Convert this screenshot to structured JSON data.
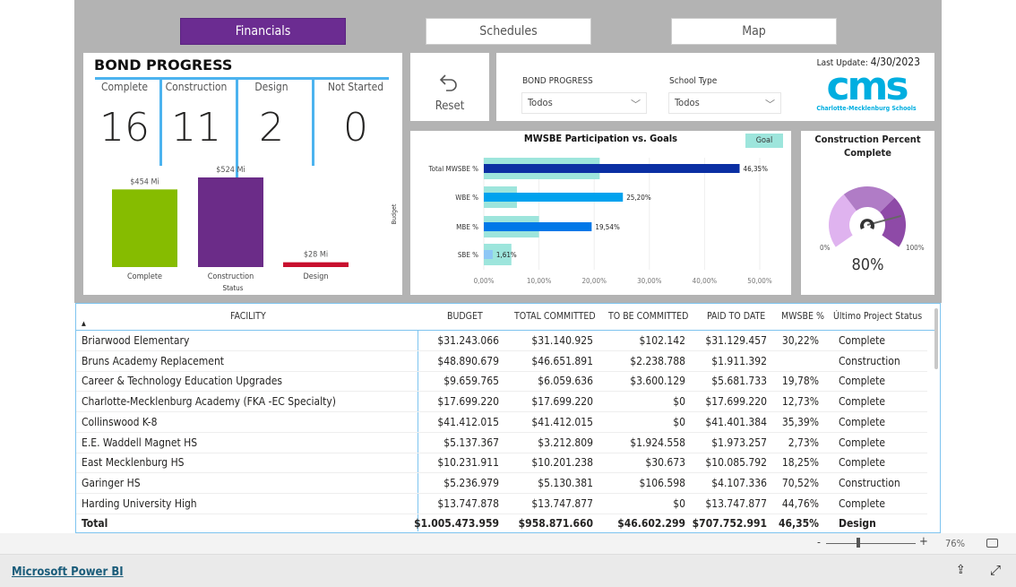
{
  "nav": {
    "tabs": [
      {
        "label": "Financials",
        "active": true
      },
      {
        "label": "Schedules",
        "active": false
      },
      {
        "label": "Map",
        "active": false
      }
    ]
  },
  "bond": {
    "title": "BOND PROGRESS",
    "kpis": [
      {
        "label": "Complete",
        "value": "16"
      },
      {
        "label": "Construction",
        "value": "11"
      },
      {
        "label": "Design",
        "value": "2"
      },
      {
        "label": "Not Started",
        "value": "0"
      }
    ]
  },
  "reset": {
    "label": "Reset",
    "icon": "undo-icon"
  },
  "filters": {
    "bond_label": "BOND PROGRESS",
    "bond_value": "Todos",
    "school_label": "School Type",
    "school_value": "Todos",
    "last_update_label": "Last Update:",
    "last_update_value": "4/30/2023"
  },
  "logo": {
    "text": "cms",
    "sub": "Charlotte-Mecklenburg Schools",
    "color": "#00aee0"
  },
  "chart_data": [
    {
      "type": "bar",
      "title": "",
      "xlabel": "Status",
      "ylabel": "Budget",
      "categories": [
        "Complete",
        "Construction",
        "Design"
      ],
      "values": [
        454,
        524,
        28
      ],
      "data_labels": [
        "$454 Mi",
        "$524 Mi",
        "$28 Mi"
      ],
      "colors": [
        "#86bc00",
        "#6b2c88",
        "#c8102e"
      ]
    },
    {
      "type": "bar",
      "orientation": "horizontal",
      "title": "MWSBE Participation vs. Goals",
      "categories": [
        "Total MWSBE %",
        "WBE %",
        "MBE %",
        "SBE %"
      ],
      "series": [
        {
          "name": "Goal",
          "values": [
            21,
            6,
            10,
            5
          ],
          "color": "#9de5dc"
        },
        {
          "values": [
            46.35,
            25.2,
            19.54,
            1.61
          ],
          "data_labels": [
            "46,35%",
            "25,20%",
            "19,54%",
            "1,61%"
          ],
          "colors": [
            "#0b2fa3",
            "#00a2ee",
            "#0078e8",
            "#8ec7f5"
          ]
        }
      ],
      "xlim": [
        0,
        50
      ],
      "xticks": [
        "0,00%",
        "10,00%",
        "20,00%",
        "30,00%",
        "40,00%",
        "50,00%"
      ],
      "legend": "top-right",
      "grid": true
    },
    {
      "type": "gauge",
      "title": "Construction Percent Complete",
      "value": 80,
      "min_label": "0%",
      "max_label": "100%",
      "value_label": "80%",
      "bands": [
        {
          "to": 35,
          "color": "#dfb3ef"
        },
        {
          "to": 68,
          "color": "#b07cc6"
        },
        {
          "to": 100,
          "color": "#8e4aa7"
        }
      ]
    }
  ],
  "table": {
    "headers": [
      "FACILITY",
      "BUDGET",
      "TOTAL COMMITTED",
      "TO BE COMMITTED",
      "PAID TO DATE",
      "MWSBE %",
      "Último Project Status"
    ],
    "rows": [
      [
        "Briarwood Elementary",
        "$31.243.066",
        "$31.140.925",
        "$102.142",
        "$31.129.457",
        "30,22%",
        "Complete"
      ],
      [
        "Bruns Academy Replacement",
        "$48.890.679",
        "$46.651.891",
        "$2.238.788",
        "$1.911.392",
        "",
        "Construction"
      ],
      [
        "Career & Technology Education Upgrades",
        "$9.659.765",
        "$6.059.636",
        "$3.600.129",
        "$5.681.733",
        "19,78%",
        "Complete"
      ],
      [
        "Charlotte-Mecklenburg Academy (FKA -EC Specialty)",
        "$17.699.220",
        "$17.699.220",
        "$0",
        "$17.699.220",
        "12,73%",
        "Complete"
      ],
      [
        "Collinswood K-8",
        "$41.412.015",
        "$41.412.015",
        "$0",
        "$41.401.384",
        "35,39%",
        "Complete"
      ],
      [
        "E.E. Waddell Magnet HS",
        "$5.137.367",
        "$3.212.809",
        "$1.924.558",
        "$1.973.257",
        "2,73%",
        "Complete"
      ],
      [
        "East Mecklenburg HS",
        "$10.231.911",
        "$10.201.238",
        "$30.673",
        "$10.085.792",
        "18,25%",
        "Complete"
      ],
      [
        "Garinger HS",
        "$5.236.979",
        "$5.130.381",
        "$106.598",
        "$4.107.336",
        "70,52%",
        "Construction"
      ],
      [
        "Harding University High",
        "$13.747.878",
        "$13.747.877",
        "$0",
        "$13.747.877",
        "44,76%",
        "Complete"
      ]
    ],
    "total": [
      "Total",
      "$1.005.473.959",
      "$958.871.660",
      "$46.602.299",
      "$707.752.991",
      "46,35%",
      "Design"
    ]
  },
  "footer": {
    "zoom": "76%",
    "brand": "Microsoft Power BI"
  }
}
